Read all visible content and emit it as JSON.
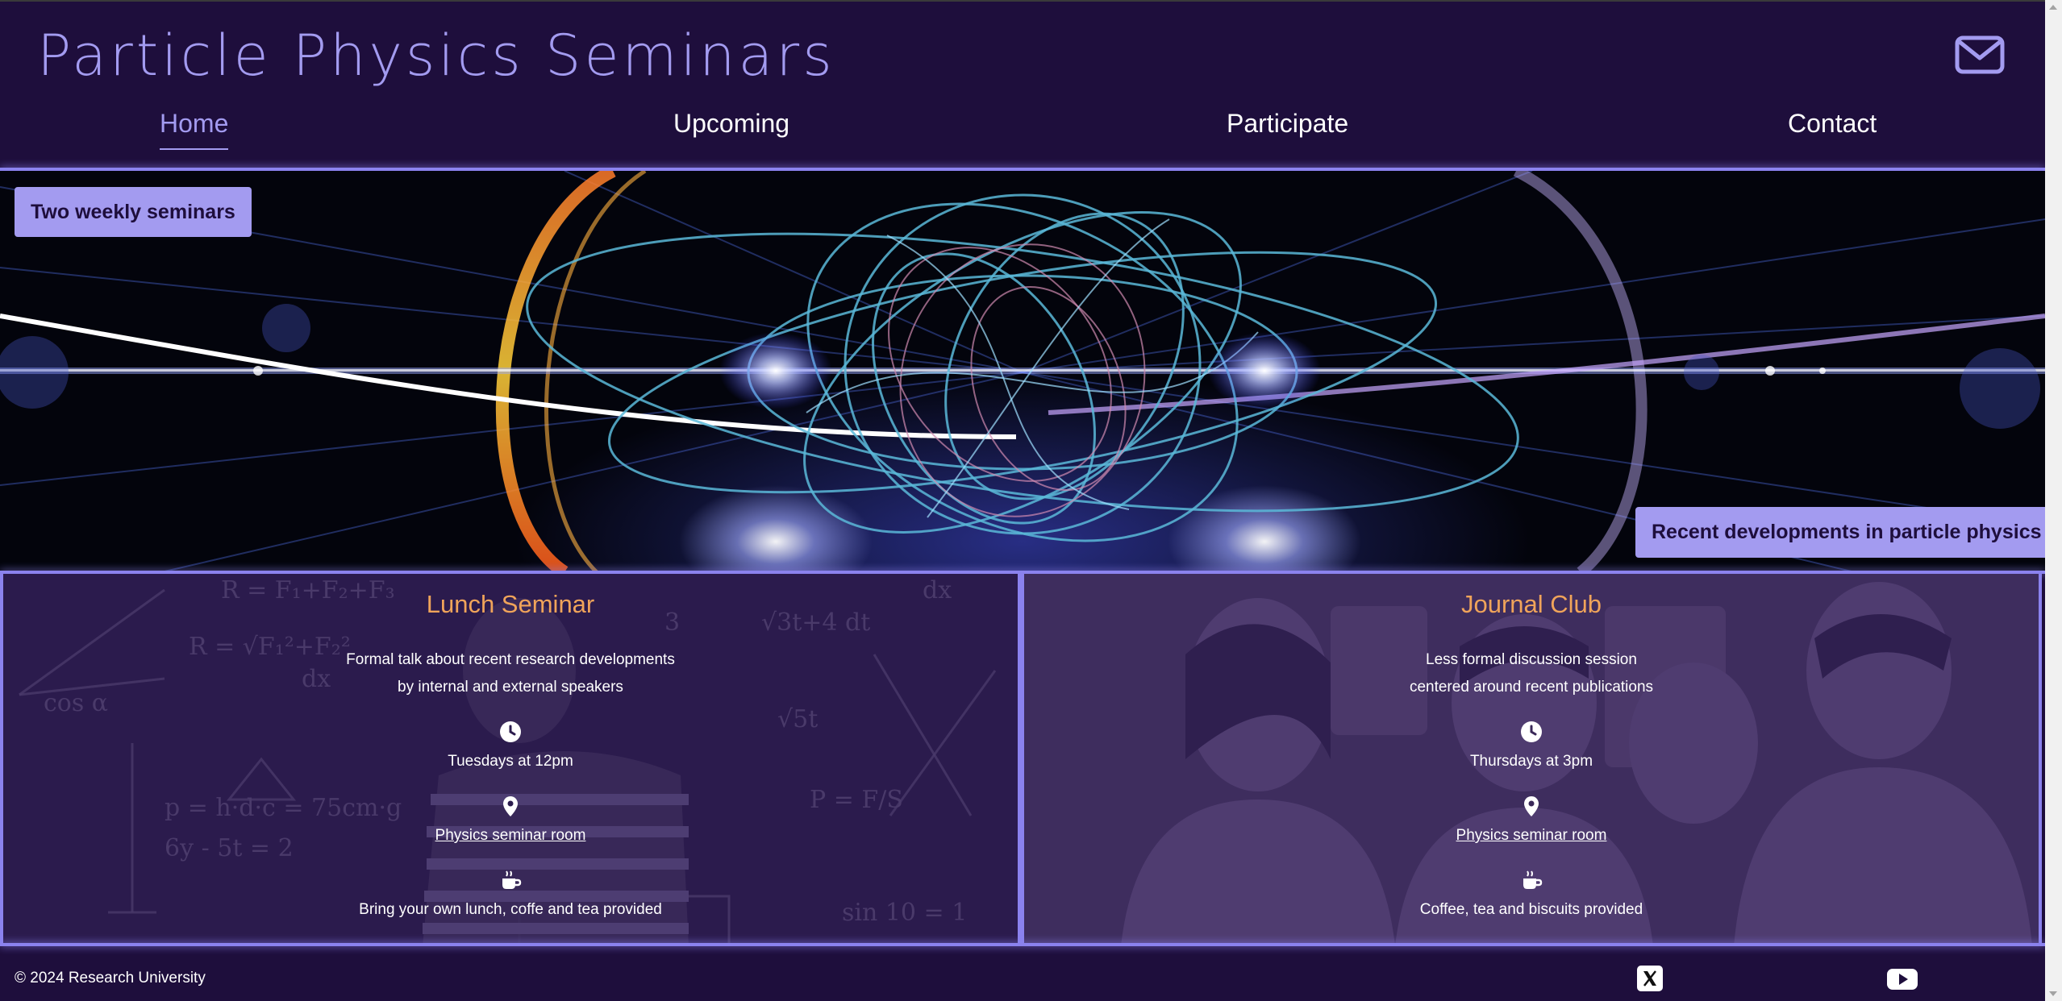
{
  "header": {
    "site_title": "Particle Physics Seminars",
    "mail_icon": "envelope-icon"
  },
  "nav": {
    "items": [
      {
        "label": "Home",
        "active": true
      },
      {
        "label": "Upcoming",
        "active": false
      },
      {
        "label": "Participate",
        "active": false
      },
      {
        "label": "Contact",
        "active": false
      }
    ]
  },
  "hero": {
    "tag_left": "Two weekly seminars",
    "tag_right": "Recent developments in particle physics"
  },
  "seminars": [
    {
      "title": "Lunch Seminar",
      "description_line1": "Formal talk about recent research developments",
      "description_line2": "by internal and external speakers",
      "time_icon": "clock-icon",
      "time": "Tuesdays at 12pm",
      "location_icon": "map-pin-icon",
      "location": "Physics seminar room",
      "refreshments_icon": "coffee-cup-icon",
      "refreshments": "Bring your own lunch, coffe and tea provided"
    },
    {
      "title": "Journal Club",
      "description_line1": "Less formal discussion session",
      "description_line2": "centered around recent publications",
      "time_icon": "clock-icon",
      "time": "Thursdays at 3pm",
      "location_icon": "map-pin-icon",
      "location": "Physics seminar room",
      "refreshments_icon": "coffee-cup-icon",
      "refreshments": "Coffee, tea and biscuits provided"
    }
  ],
  "footer": {
    "copyright": "© 2024 Research University",
    "social": [
      "x-twitter-icon",
      "youtube-icon"
    ]
  },
  "colors": {
    "background": "#1e0e3c",
    "accent": "#a39bf0",
    "heading_orange": "#f0a45a"
  }
}
